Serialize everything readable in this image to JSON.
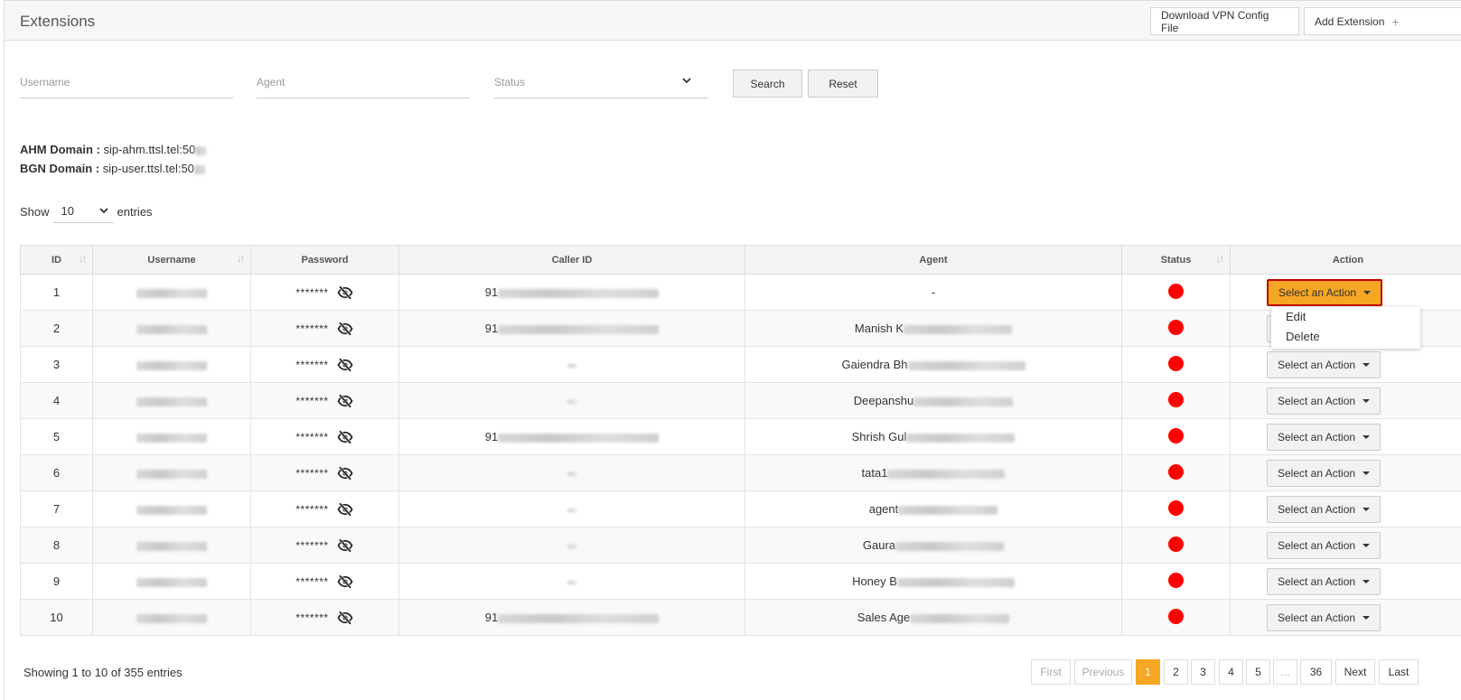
{
  "header": {
    "title": "Extensions",
    "download_label": "Download VPN Config File",
    "add_label": "Add Extension",
    "add_icon": "+"
  },
  "filters": {
    "username_placeholder": "Username",
    "agent_placeholder": "Agent",
    "status_placeholder": "Status",
    "search_label": "Search",
    "reset_label": "Reset"
  },
  "domains": {
    "ahm_label": "AHM Domain :",
    "ahm_value": "sip-ahm.ttsl.tel:50",
    "bgn_label": "BGN Domain :",
    "bgn_value": "sip-user.ttsl.tel:50"
  },
  "length": {
    "show_label": "Show",
    "value": "10",
    "entries_label": "entries"
  },
  "table": {
    "headers": [
      "ID",
      "Username",
      "Password",
      "Caller ID",
      "Agent",
      "Status",
      "Action"
    ],
    "rows": [
      {
        "id": "1",
        "password": "*******",
        "caller_prefix": "91",
        "agent": "-",
        "action": "Select an Action"
      },
      {
        "id": "2",
        "password": "*******",
        "caller_prefix": "91",
        "agent": "Manish K",
        "action": "Select an Action"
      },
      {
        "id": "3",
        "password": "*******",
        "caller_prefix": "",
        "agent": "Gaiendra Bh",
        "action": "Select an Action"
      },
      {
        "id": "4",
        "password": "*******",
        "caller_prefix": "",
        "agent": "Deepanshu",
        "action": "Select an Action"
      },
      {
        "id": "5",
        "password": "*******",
        "caller_prefix": "91",
        "agent": "Shrish Gul",
        "action": "Select an Action"
      },
      {
        "id": "6",
        "password": "*******",
        "caller_prefix": "",
        "agent": "tata1",
        "action": "Select an Action"
      },
      {
        "id": "7",
        "password": "*******",
        "caller_prefix": "",
        "agent": "agent",
        "action": "Select an Action"
      },
      {
        "id": "8",
        "password": "*******",
        "caller_prefix": "",
        "agent": "Gaura",
        "action": "Select an Action"
      },
      {
        "id": "9",
        "password": "*******",
        "caller_prefix": "",
        "agent": "Honey B",
        "action": "Select an Action"
      },
      {
        "id": "10",
        "password": "*******",
        "caller_prefix": "91",
        "agent": "Sales Age",
        "action": "Select an Action"
      }
    ],
    "status_color": "#ff0000"
  },
  "action_menu": {
    "edit_label": "Edit",
    "delete_label": "Delete"
  },
  "footer": {
    "info": "Showing 1 to 10 of 355 entries",
    "first": "First",
    "previous": "Previous",
    "pages": [
      "1",
      "2",
      "3",
      "4",
      "5",
      "...",
      "36"
    ],
    "current_page": "1",
    "next": "Next",
    "last": "Last"
  },
  "colors": {
    "accent": "#f5a623",
    "highlight_border": "#c00000"
  },
  "icons": {
    "eye": "eye-slash-icon",
    "sort": "sort-icon",
    "dropdown": "chevron-down-icon"
  }
}
